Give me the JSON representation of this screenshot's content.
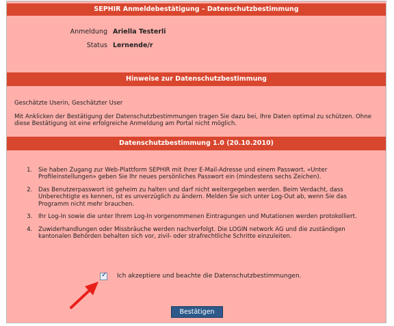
{
  "window": {
    "title": "SEPHIR Anmeldebestätigung – Datenschutzbestimmung"
  },
  "login_info": {
    "anmeldung_label": "Anmeldung",
    "anmeldung_value": "Ariella Testerli",
    "status_label": "Status",
    "status_value": "Lernende/r"
  },
  "notes_section": {
    "title": "Hinweise zur Datenschutzbestimmung",
    "greeting": "Geschätzte Userin, Geschätzter User",
    "body": "Mit Anklicken der Bestätigung der Datenschutzbestimmungen tragen Sie dazu bei, Ihre Daten optimal zu schützen. Ohne diese Bestätigung ist eine erfolgreiche Anmeldung am Portal nicht möglich."
  },
  "policy_section": {
    "title": "Datenschutzbestimmung 1.0 (20.10.2010)",
    "items": [
      "Sie haben Zugang zur Web-Plattform SEPHIR mit Ihrer E-Mail-Adresse und einem Passwort. «Unter Profileinstellungen» geben Sie Ihr neues persönliches Passwort ein (mindestens sechs Zeichen).",
      "Das Benutzerpasswort ist geheim zu halten und darf nicht weitergegeben werden. Beim Verdacht, dass Unberechtigte es kennen, ist es unverzüglich zu ändern. Melden Sie sich unter Log-Out ab, wenn Sie das Programm nicht mehr brauchen.",
      "Ihr Log-In sowie die unter Ihrem Log-In vorgenommenen Eintragungen und Mutationen werden protokolliert.",
      "Zuwiderhandlungen oder Missbräuche werden nachverfolgt. Die LOGIN network AG und die zuständigen kantonalen Behörden behalten sich vor, zivil- oder strafrechtliche Schritte einzuleiten."
    ]
  },
  "acceptance": {
    "checkbox_checked": true,
    "label": "Ich akzeptiere und beachte die Datenschutzbestimmungen."
  },
  "confirm_button": {
    "label": "Bestätigen"
  },
  "colors": {
    "background": "#ffb0ab",
    "header_bar": "#d9462e",
    "button": "#2d5a8a",
    "arrow": "#e8201a"
  }
}
